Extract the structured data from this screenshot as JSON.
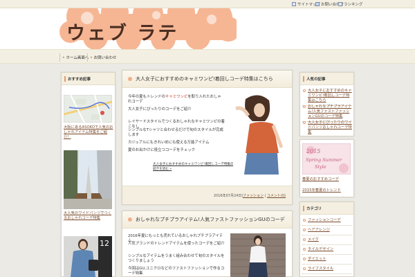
{
  "top_links": [
    "サイトマップ",
    "お問い合わせ",
    "ランキング"
  ],
  "site": {
    "logo": "ウェブ ラテ"
  },
  "nav": [
    "ホーム画面へ",
    "お問い合わせ"
  ],
  "left_sidebar": {
    "title": "おすすめ記事",
    "items": [
      {
        "caption": "大阪にあるASOKOで人気のおしゃれアイテム特集をご紹介！"
      },
      {
        "caption": "大人気のワイドパンツでつくるおしゃれコーデ特集"
      },
      {
        "caption": ""
      }
    ]
  },
  "articles": [
    {
      "title": "大人女子におすすめのキャミワンピ!着回しコーデ特集はこちら",
      "lines": [
        [
          "今年の夏もトレンドの",
          "キャミワンピ",
          "を取り入れたおしゃれコーデ"
        ],
        [
          "大人女子にぴったりのコーデをご紹介"
        ],
        [
          "レイヤードスタイルでつくるおしゃれなキャミワンピの着こなし"
        ],
        [
          "シンプルなTシャツと合わせるだけで旬のスタイルが完成します"
        ],
        [
          "カジュアルにもきれいめにも使える万能アイテム"
        ],
        [
          "夏のお出かけに役立つコーデをチェック"
        ]
      ],
      "more": "大人女子におすすめのキャミワンピ!着回しコーデ特集の続きを読む »",
      "meta": "2016年07月24日",
      "meta_links": [
        "ファッション",
        "コメント(0)"
      ]
    },
    {
      "title": "おしゃれなプチプラアイテム!人気ファストファッションGUのコーデ",
      "lines": [
        [
          "2016年夏にもっとも売れているおしゃれプチプラアイテム"
        ],
        [
          "人気ブランドのトレンドアイテムを使ったコーデをご紹介"
        ],
        [
          "シンプルなアイテムをうまく組み合わせて旬のスタイルをつくりましょう"
        ],
        [
          "今回はGU,ユニクロなどのファストファッションで作るコーデ特集"
        ]
      ]
    }
  ],
  "right_sidebar": {
    "box1_title": "人気の記事",
    "box1_items": [
      "大人女子におすすめのキャミワンピ!着回しコーデ特集はこちら",
      "おしゃれなプチプラアイテム!人気ファストファッションGUのコーデ特集",
      "大人女子にぴったりのワイドパンツおしゃれコーデ特集"
    ],
    "banner": "2015 Spring Summer Style",
    "banner_caption": "春夏のおすすめコーデ",
    "banner_caption2": "2015年春夏のトレンド",
    "box2_title": "カテゴリ",
    "box2_items": [
      "ファッションコーデ",
      "ヘアアレンジ",
      "メイク",
      "ネイルデザイン",
      "ダイエット",
      "ライフスタイル"
    ]
  },
  "colors": {
    "accent": "#e59a6a",
    "header_cloud": "#f6b694",
    "band": "#eceae5",
    "nav_bg": "#f3efe2"
  }
}
